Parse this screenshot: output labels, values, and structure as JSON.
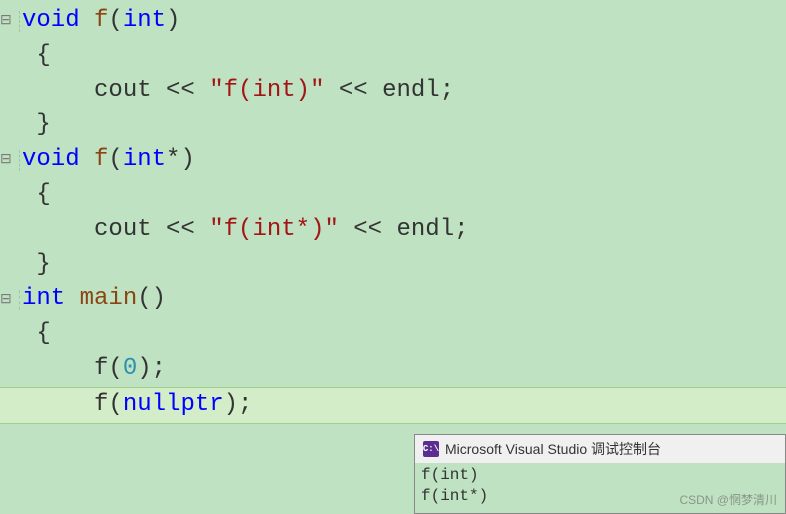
{
  "code": {
    "lines": [
      {
        "gutter": "⊟",
        "tokens": [
          {
            "t": "void",
            "c": "kw-blue"
          },
          {
            "t": " ",
            "c": ""
          },
          {
            "t": "f",
            "c": "identifier"
          },
          {
            "t": "(",
            "c": "punct"
          },
          {
            "t": "int",
            "c": "kw-blue"
          },
          {
            "t": ")",
            "c": "punct"
          }
        ]
      },
      {
        "gutter": "",
        "tokens": [
          {
            "t": " {",
            "c": "punct"
          }
        ]
      },
      {
        "gutter": "",
        "tokens": [
          {
            "t": "     cout ",
            "c": "var"
          },
          {
            "t": "<< ",
            "c": "op"
          },
          {
            "t": "\"f(int)\"",
            "c": "string"
          },
          {
            "t": " << ",
            "c": "op"
          },
          {
            "t": "endl",
            "c": "var"
          },
          {
            "t": ";",
            "c": "punct"
          }
        ]
      },
      {
        "gutter": "",
        "tokens": [
          {
            "t": " }",
            "c": "punct"
          }
        ]
      },
      {
        "gutter": "⊟",
        "tokens": [
          {
            "t": "void",
            "c": "kw-blue"
          },
          {
            "t": " ",
            "c": ""
          },
          {
            "t": "f",
            "c": "identifier"
          },
          {
            "t": "(",
            "c": "punct"
          },
          {
            "t": "int",
            "c": "kw-blue"
          },
          {
            "t": "*)",
            "c": "punct"
          }
        ]
      },
      {
        "gutter": "",
        "tokens": [
          {
            "t": " {",
            "c": "punct"
          }
        ]
      },
      {
        "gutter": "",
        "tokens": [
          {
            "t": "     cout ",
            "c": "var"
          },
          {
            "t": "<< ",
            "c": "op"
          },
          {
            "t": "\"f(int*)\"",
            "c": "string"
          },
          {
            "t": " << ",
            "c": "op"
          },
          {
            "t": "endl",
            "c": "var"
          },
          {
            "t": ";",
            "c": "punct"
          }
        ]
      },
      {
        "gutter": "",
        "tokens": [
          {
            "t": " }",
            "c": "punct"
          }
        ]
      },
      {
        "gutter": "⊟",
        "tokens": [
          {
            "t": "int",
            "c": "kw-blue"
          },
          {
            "t": " ",
            "c": ""
          },
          {
            "t": "main",
            "c": "identifier"
          },
          {
            "t": "()",
            "c": "punct"
          }
        ]
      },
      {
        "gutter": "",
        "tokens": [
          {
            "t": " {",
            "c": "punct"
          }
        ]
      },
      {
        "gutter": "",
        "tokens": [
          {
            "t": "     f",
            "c": "var"
          },
          {
            "t": "(",
            "c": "punct"
          },
          {
            "t": "0",
            "c": "kw-teal"
          },
          {
            "t": ");",
            "c": "punct"
          }
        ]
      },
      {
        "gutter": "",
        "highlight": true,
        "tokens": [
          {
            "t": "     f",
            "c": "var"
          },
          {
            "t": "(",
            "c": "punct"
          },
          {
            "t": "nullptr",
            "c": "kw-blue"
          },
          {
            "t": ");",
            "c": "punct"
          }
        ]
      }
    ]
  },
  "console": {
    "icon_text": "C:\\",
    "title": "Microsoft Visual Studio 调试控制台",
    "output": [
      "f(int)",
      "f(int*)"
    ],
    "watermark": "CSDN @惘梦清川"
  }
}
